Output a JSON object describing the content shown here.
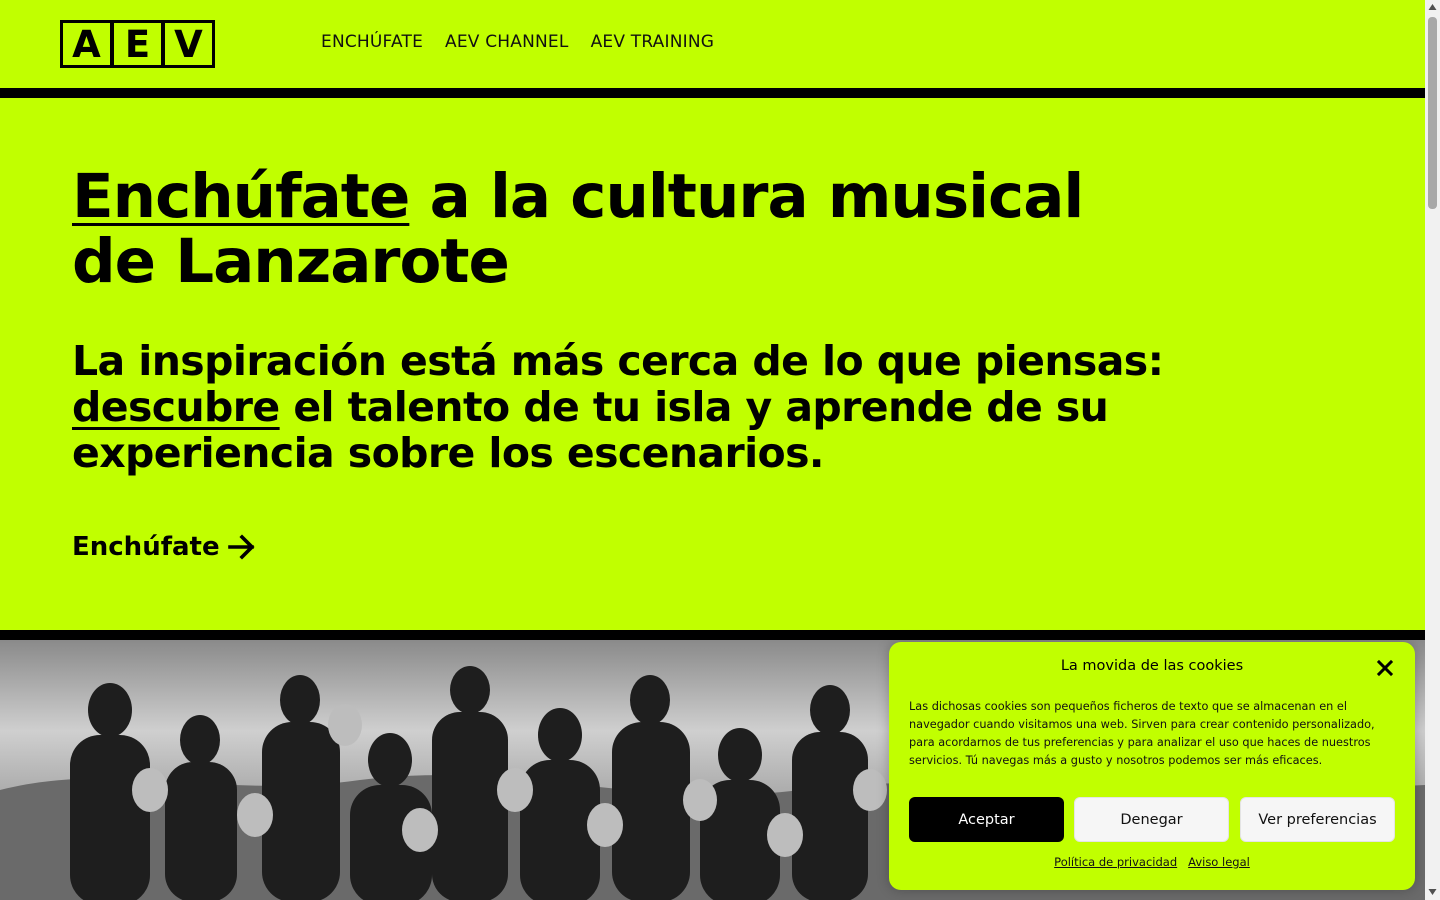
{
  "header": {
    "logo_letters": [
      "A",
      "E",
      "V"
    ],
    "nav": [
      "ENCHÚFATE",
      "AEV CHANNEL",
      "AEV TRAINING"
    ]
  },
  "hero": {
    "title_link": "Enchúfate",
    "title_rest": " a la cultura musical de Lanzarote",
    "subtitle_before": "La inspiración está más cerca de lo que piensas: ",
    "subtitle_link": "descubre",
    "subtitle_after": " el talento de tu isla y aprende de su experiencia sobre los escenarios.",
    "cta_label": "Enchúfate",
    "cta_icon": "arrow-right-icon"
  },
  "cookie_banner": {
    "title": "La movida de las cookies",
    "close_icon": "close-icon",
    "text": "Las dichosas cookies son pequeños ficheros de texto que se almacenan en el navegador cuando visitamos una web. Sirven para crear contenido personalizado, para acordarnos de tus preferencias y para analizar el uso que haces de nuestros servicios. Tú navegas más a gusto y nosotros podemos ser más eficaces.",
    "accept_label": "Aceptar",
    "deny_label": "Denegar",
    "preferences_label": "Ver preferencias",
    "privacy_link": "Política de privacidad",
    "legal_link": "Aviso legal"
  },
  "colors": {
    "accent": "#c1ff00",
    "ink": "#000000",
    "button_light": "#f6f6f6"
  }
}
